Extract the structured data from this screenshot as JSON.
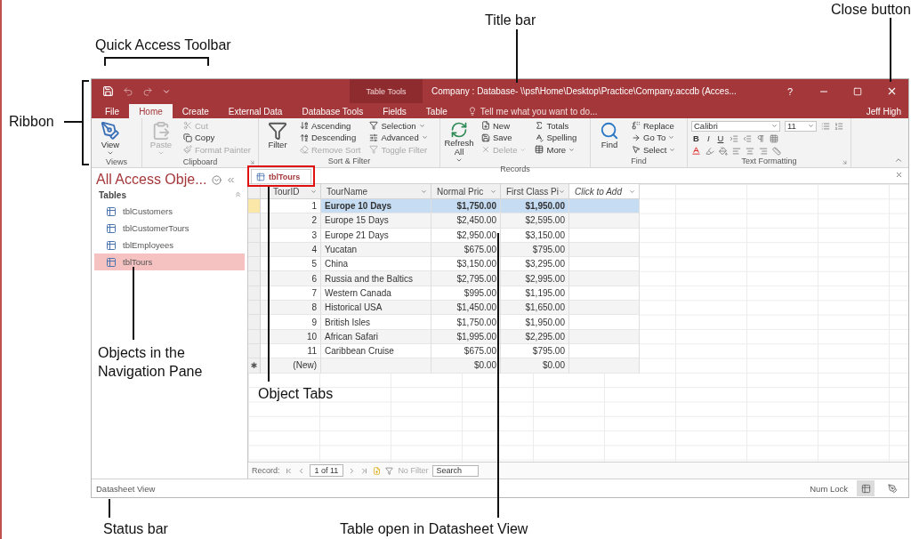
{
  "window": {
    "title": "Company : Database- \\\\psf\\Home\\Desktop\\Practice\\Company.accdb (Acces...",
    "context_label": "Table Tools",
    "help": "?",
    "user": "Jeff High"
  },
  "ribbon_tabs": [
    {
      "label": "File",
      "selected": false
    },
    {
      "label": "Home",
      "selected": true
    },
    {
      "label": "Create",
      "selected": false
    },
    {
      "label": "External Data",
      "selected": false
    },
    {
      "label": "Database Tools",
      "selected": false
    },
    {
      "label": "Fields",
      "selected": false
    },
    {
      "label": "Table",
      "selected": false
    }
  ],
  "tell_me": {
    "placeholder": "Tell me what you want to do..."
  },
  "ribbon_groups": [
    {
      "name": "Views",
      "kind": "commands",
      "launcher": false,
      "large": [
        {
          "label": "View",
          "dropdown": true,
          "disabled": false
        }
      ]
    },
    {
      "name": "Clipboard",
      "kind": "commands",
      "launcher": true,
      "large": [
        {
          "label": "Paste",
          "dropdown": true,
          "disabled": true
        }
      ],
      "small": [
        {
          "label": "Cut",
          "dropdown": false,
          "disabled": true
        },
        {
          "label": "Copy",
          "dropdown": false,
          "disabled": false
        },
        {
          "label": "Format Painter",
          "dropdown": false,
          "disabled": true
        }
      ]
    },
    {
      "name": "Sort & Filter",
      "kind": "commands",
      "launcher": false,
      "large": [
        {
          "label": "Filter",
          "dropdown": false,
          "disabled": false
        }
      ],
      "small": [
        {
          "label": "Ascending",
          "dropdown": false,
          "disabled": false
        },
        {
          "label": "Descending",
          "dropdown": false,
          "disabled": false
        },
        {
          "label": "Remove Sort",
          "dropdown": false,
          "disabled": true
        },
        {
          "label": "Selection",
          "dropdown": true,
          "disabled": false
        },
        {
          "label": "Advanced",
          "dropdown": true,
          "disabled": false
        },
        {
          "label": "Toggle Filter",
          "dropdown": false,
          "disabled": true
        }
      ]
    },
    {
      "name": "Records",
      "kind": "commands",
      "launcher": false,
      "large": [
        {
          "label": "Refresh All",
          "dropdown": true,
          "disabled": false
        }
      ],
      "small": [
        {
          "label": "New",
          "dropdown": false,
          "disabled": false
        },
        {
          "label": "Save",
          "dropdown": false,
          "disabled": false
        },
        {
          "label": "Delete",
          "dropdown": true,
          "disabled": true
        },
        {
          "label": "Totals",
          "dropdown": false,
          "disabled": false
        },
        {
          "label": "Spelling",
          "dropdown": false,
          "disabled": false
        },
        {
          "label": "More",
          "dropdown": true,
          "disabled": false
        }
      ]
    },
    {
      "name": "Find",
      "kind": "commands",
      "launcher": false,
      "large": [
        {
          "label": "Find",
          "dropdown": false,
          "disabled": false
        }
      ],
      "small": [
        {
          "label": "Replace",
          "dropdown": false,
          "disabled": false
        },
        {
          "label": "Go To",
          "dropdown": true,
          "disabled": false
        },
        {
          "label": "Select",
          "dropdown": true,
          "disabled": false
        }
      ]
    },
    {
      "name": "Text Formatting",
      "kind": "font",
      "launcher": true,
      "font": "Calibri",
      "size": "11",
      "format_buttons": [
        "B",
        "I",
        "U"
      ]
    }
  ],
  "nav_pane": {
    "title": "All Access Obje...",
    "section": "Tables",
    "items": [
      {
        "label": "tblCustomers",
        "selected": false
      },
      {
        "label": "tblCustomerTours",
        "selected": false
      },
      {
        "label": "tblEmployees",
        "selected": false
      },
      {
        "label": "tblTours",
        "selected": true
      }
    ]
  },
  "object_tabs": [
    {
      "label": "tblTours",
      "selected": true
    }
  ],
  "datasheet": {
    "columns": [
      {
        "label": "TourID",
        "kind": "field"
      },
      {
        "label": "TourName",
        "kind": "field"
      },
      {
        "label": "Normal Pric",
        "kind": "field"
      },
      {
        "label": "First Class Pi",
        "kind": "field"
      },
      {
        "label": "Click to Add",
        "kind": "add"
      }
    ],
    "rows": [
      {
        "cells": [
          "1",
          "Europe 10 Days",
          "$1,750.00",
          "$1,950.00"
        ],
        "selected": true
      },
      {
        "cells": [
          "2",
          "Europe 15 Days",
          "$2,450.00",
          "$2,595.00"
        ],
        "selected": false
      },
      {
        "cells": [
          "3",
          "Europe 21 Days",
          "$2,950.00",
          "$3,150.00"
        ],
        "selected": false
      },
      {
        "cells": [
          "4",
          "Yucatan",
          "$675.00",
          "$795.00"
        ],
        "selected": false
      },
      {
        "cells": [
          "5",
          "China",
          "$3,150.00",
          "$3,295.00"
        ],
        "selected": false
      },
      {
        "cells": [
          "6",
          "Russia and the Baltics",
          "$2,795.00",
          "$2,995.00"
        ],
        "selected": false
      },
      {
        "cells": [
          "7",
          "Western Canada",
          "$995.00",
          "$1,195.00"
        ],
        "selected": false
      },
      {
        "cells": [
          "8",
          "Historical USA",
          "$1,450.00",
          "$1,650.00"
        ],
        "selected": false
      },
      {
        "cells": [
          "9",
          "British Isles",
          "$1,750.00",
          "$1,950.00"
        ],
        "selected": false
      },
      {
        "cells": [
          "10",
          "African Safari",
          "$1,995.00",
          "$2,295.00"
        ],
        "selected": false
      },
      {
        "cells": [
          "11",
          "Caribbean Cruise",
          "$675.00",
          "$795.00"
        ],
        "selected": false
      }
    ],
    "new_row": {
      "marker": "✱",
      "id": "(New)",
      "normal": "$0.00",
      "first": "$0.00"
    }
  },
  "record_nav": {
    "label": "Record:",
    "position": "1 of 11",
    "filter": "No Filter",
    "search": {
      "placeholder": "Search"
    }
  },
  "status_bar": {
    "view": "Datasheet View",
    "indicator": "Num Lock"
  },
  "callouts": [
    {
      "text": "Quick Access Toolbar"
    },
    {
      "text": "Title bar"
    },
    {
      "text": "Close button"
    },
    {
      "text": "Ribbon"
    },
    {
      "text": "Objects in the Navigation Pane"
    },
    {
      "text": "Object Tabs"
    },
    {
      "text": "Status bar"
    },
    {
      "text": "Table open in Datasheet View"
    }
  ]
}
